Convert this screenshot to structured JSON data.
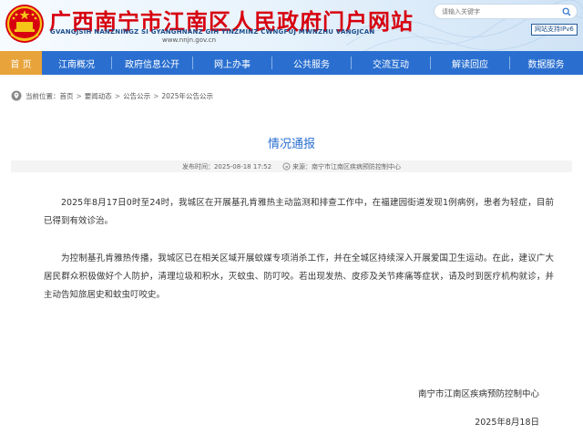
{
  "header": {
    "site_title": "广西南宁市江南区人民政府门户网站",
    "site_subtitle": "GVANGJSIH NANZNINGZ SI GYANGHNANZ GIH YINZMINZ CWNGFUJ MWNZHU VANGJCAN",
    "site_url": "www.nnjn.gov.cn",
    "search_placeholder": "请输入关键字",
    "ipv6_badge": "网站支持IPv6",
    "emblem_icon": "national-emblem-icon",
    "search_icon": "search-icon"
  },
  "nav": {
    "items": [
      {
        "label": "首 页",
        "active": true
      },
      {
        "label": "江南概况",
        "active": false
      },
      {
        "label": "政府信息公开",
        "active": false
      },
      {
        "label": "网上办事",
        "active": false
      },
      {
        "label": "公共服务",
        "active": false
      },
      {
        "label": "交流互动",
        "active": false
      },
      {
        "label": "解读回应",
        "active": false
      },
      {
        "label": "数据服务",
        "active": false
      }
    ],
    "bg_color": "#2a6fd0",
    "active_color": "#e8a33a"
  },
  "breadcrumb": {
    "icon": "location-icon",
    "prefix": "当前位置：",
    "items": [
      "首页",
      "要闻动态",
      "公告公示",
      "2025年公告公示"
    ],
    "separator": ">"
  },
  "article": {
    "title": "情况通报",
    "publish_label": "发布时间：",
    "publish_time": "2025-08-18 17:52",
    "source_label": "来源：",
    "source": "南宁市江南区疾病预防控制中心",
    "paragraphs": [
      "2025年8月17日0时至24时，我城区在开展基孔肯雅热主动监测和排查工作中，在福建园街道发现1例病例，患者为轻症，目前已得到有效诊治。",
      "为控制基孔肯雅热传播，我城区已在相关区域开展蚊媒专项消杀工作，并在全城区持续深入开展爱国卫生运动。在此，建议广大居民群众积极做好个人防护，清理垃圾和积水，灭蚊虫、防叮咬。若出现发热、皮疹及关节疼痛等症状，请及时到医疗机构就诊，并主动告知旅居史和蚊虫叮咬史。"
    ],
    "signature_org": "南宁市江南区疾病预防控制中心",
    "signature_date": "2025年8月18日"
  }
}
